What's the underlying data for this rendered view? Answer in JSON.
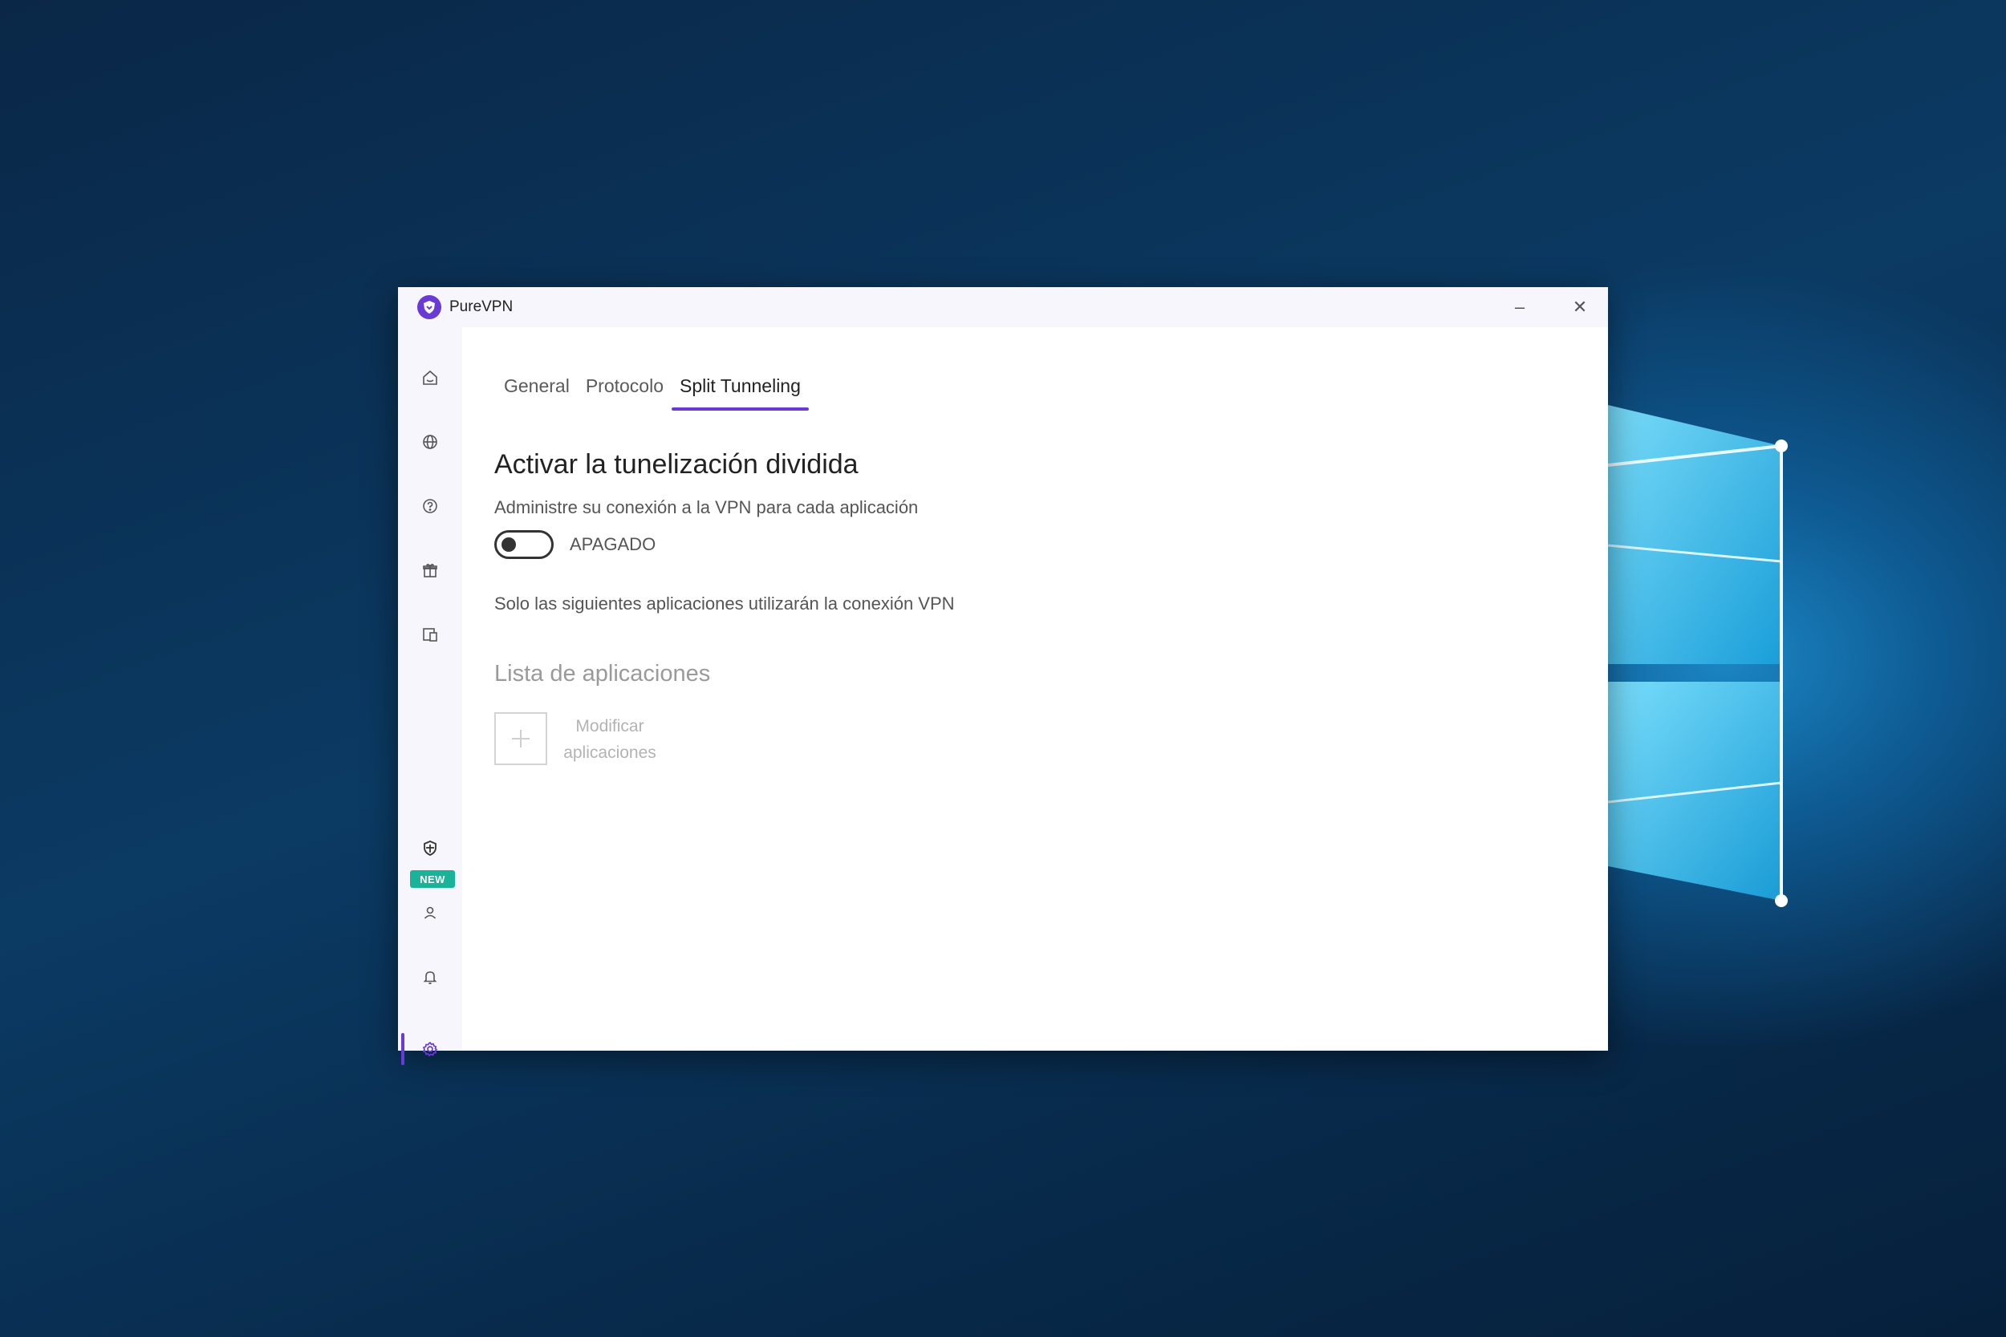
{
  "window": {
    "app_title": "PureVPN",
    "minimize_glyph": "–",
    "close_glyph": "✕"
  },
  "sidebar": {
    "items": [
      {
        "name": "home-icon",
        "active": false
      },
      {
        "name": "globe-icon",
        "active": false
      },
      {
        "name": "help-icon",
        "active": false
      },
      {
        "name": "gift-icon",
        "active": false
      },
      {
        "name": "devices-icon",
        "active": false
      },
      {
        "name": "shield-plus-icon",
        "active": false,
        "badge": "NEW"
      },
      {
        "name": "user-icon",
        "active": false
      },
      {
        "name": "bell-icon",
        "active": false
      },
      {
        "name": "gear-icon",
        "active": true
      }
    ],
    "new_badge": "NEW"
  },
  "tabs": [
    {
      "label": "General",
      "active": false
    },
    {
      "label": "Protocolo",
      "active": false
    },
    {
      "label": "Split Tunneling",
      "active": true
    }
  ],
  "split_tunneling": {
    "title": "Activar la tunelización dividida",
    "description": "Administre su conexión a la VPN para cada aplicación",
    "toggle_state": "off",
    "toggle_label": "APAGADO",
    "only_apps_text": "Solo las siguientes aplicaciones utilizarán la conexión VPN",
    "list_title": "Lista de aplicaciones",
    "add_apps_label": "Modificar aplicaciones"
  },
  "colors": {
    "accent": "#6a3bd4",
    "badge": "#19b39a",
    "sidebar_bg": "#f7f6fc"
  }
}
